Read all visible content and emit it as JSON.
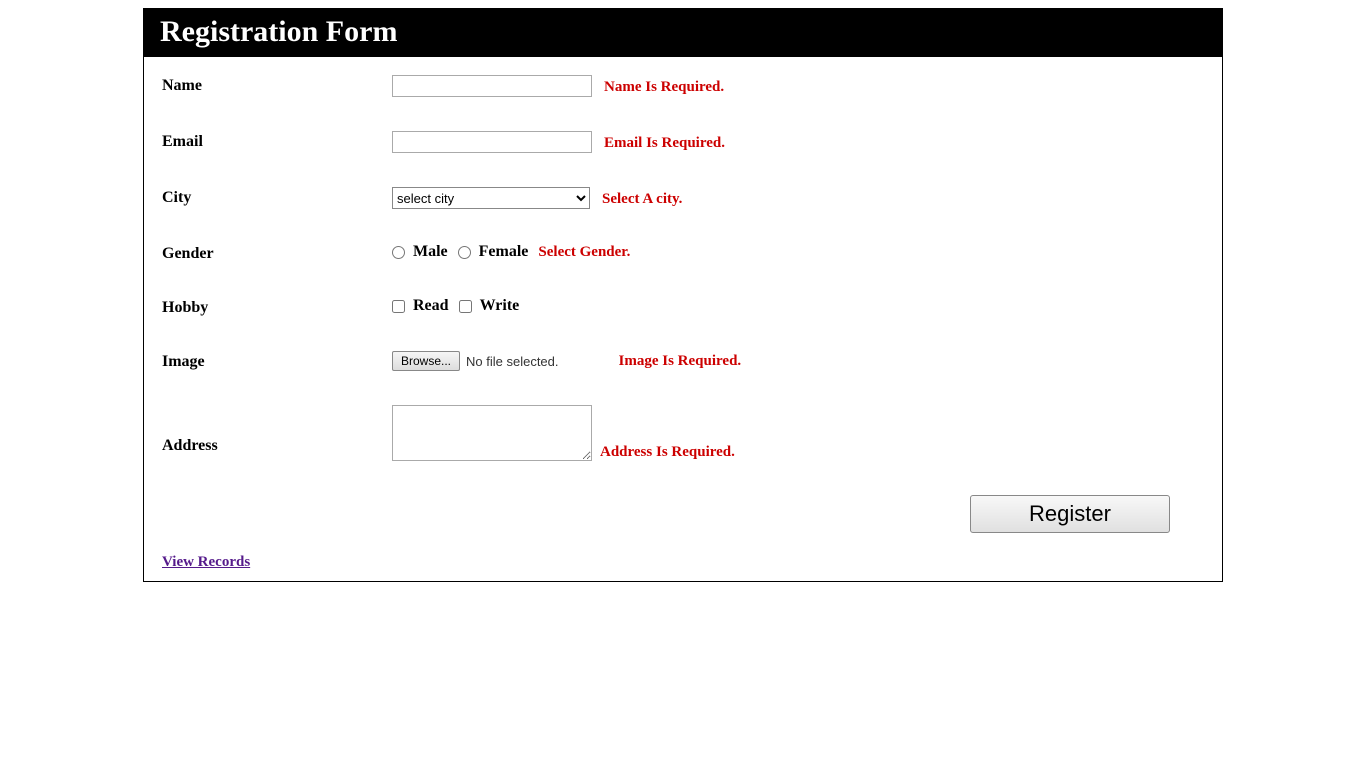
{
  "header": {
    "title": "Registration Form"
  },
  "fields": {
    "name": {
      "label": "Name",
      "value": "",
      "error": "Name Is Required."
    },
    "email": {
      "label": "Email",
      "value": "",
      "error": "Email Is Required."
    },
    "city": {
      "label": "City",
      "selected": "select city",
      "error": "Select A city."
    },
    "gender": {
      "label": "Gender",
      "male": "Male",
      "female": "Female",
      "error": "Select Gender."
    },
    "hobby": {
      "label": "Hobby",
      "read": "Read",
      "write": "Write"
    },
    "image": {
      "label": "Image",
      "browse": "Browse...",
      "nofile": "No file selected.",
      "error": "Image Is Required."
    },
    "address": {
      "label": "Address",
      "value": "",
      "error": "Address Is Required."
    }
  },
  "buttons": {
    "register": "Register"
  },
  "links": {
    "view_records": "View Records"
  }
}
